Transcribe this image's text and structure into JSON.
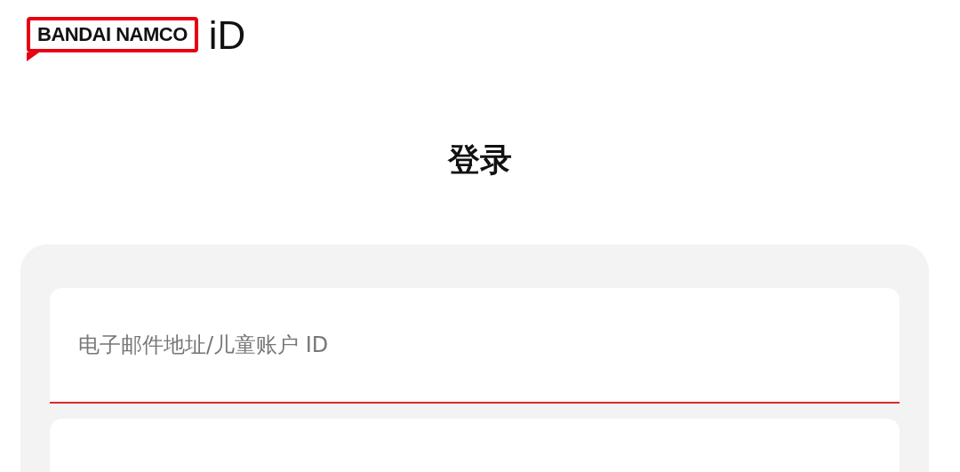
{
  "logo": {
    "brand": "BANDAI NAMCO",
    "suffix": "iD"
  },
  "title": "登录",
  "fields": [
    {
      "kind": "text",
      "placeholder": "电子邮件地址/儿童账户 ID",
      "focused": true
    },
    {
      "kind": "text"
    }
  ]
}
